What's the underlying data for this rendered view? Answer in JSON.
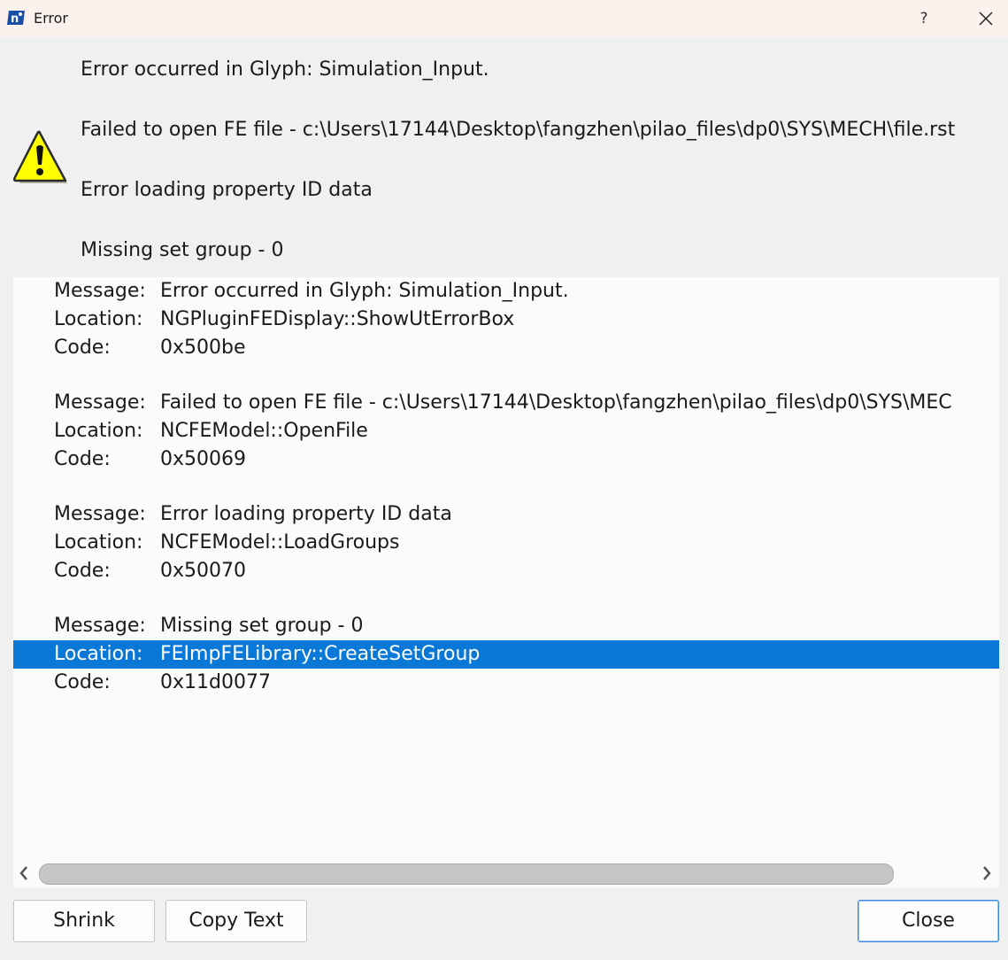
{
  "window": {
    "title": "Error",
    "help_label": "?",
    "app_icon": "nastran-logo-icon",
    "close_icon": "close-icon"
  },
  "summary": {
    "icon": "warning-icon",
    "lines": [
      "Error occurred in Glyph: Simulation_Input.",
      "Failed to open FE file - c:\\Users\\17144\\Desktop\\fangzhen\\pilao_files\\dp0\\SYS\\MECH\\file.rst",
      "Error loading property ID data",
      "Missing set group - 0"
    ]
  },
  "details": {
    "rows": [
      {
        "key": "Message:",
        "value": "Error occurred in Glyph: Simulation_Input."
      },
      {
        "key": "Location:",
        "value": "NGPluginFEDisplay::ShowUtErrorBox"
      },
      {
        "key": "Code:",
        "value": "0x500be"
      },
      {
        "key": "Message:",
        "value": "Failed to open FE file - c:\\Users\\17144\\Desktop\\fangzhen\\pilao_files\\dp0\\SYS\\MEC"
      },
      {
        "key": "Location:",
        "value": "NCFEModel::OpenFile"
      },
      {
        "key": "Code:",
        "value": "0x50069"
      },
      {
        "key": "Message:",
        "value": "Error loading property ID data"
      },
      {
        "key": "Location:",
        "value": "NCFEModel::LoadGroups"
      },
      {
        "key": "Code:",
        "value": "0x50070"
      },
      {
        "key": "Message:",
        "value": "Missing set group - 0"
      },
      {
        "key": "Location:",
        "value": "FEImpFELibrary::CreateSetGroup"
      },
      {
        "key": "Code:",
        "value": "0x11d0077"
      }
    ],
    "selected_row": 10
  },
  "buttons": {
    "shrink": "Shrink",
    "copy_text": "Copy Text",
    "close": "Close"
  },
  "colors": {
    "selection": "#0a78d7",
    "warning_yellow": "#ffff00",
    "title_bar": "#fbf2ee"
  }
}
